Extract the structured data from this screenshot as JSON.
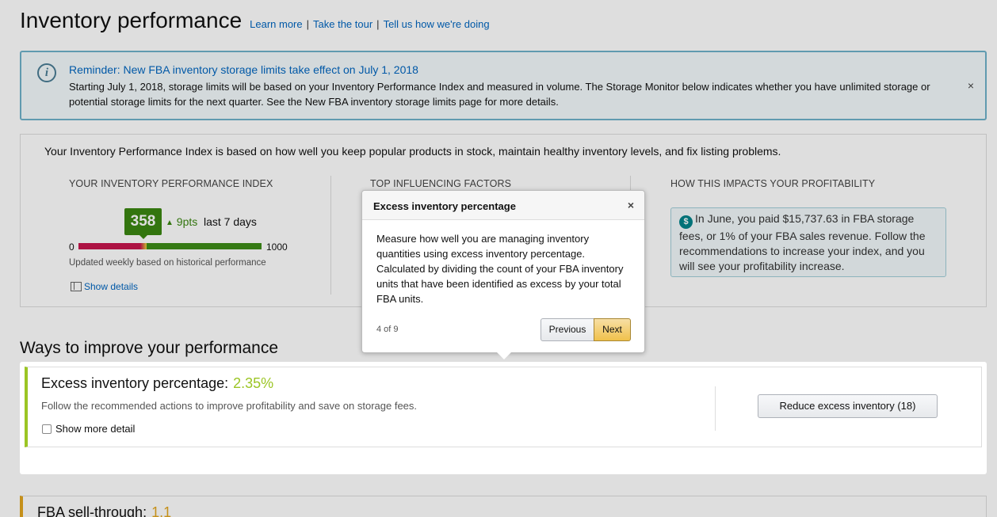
{
  "header": {
    "title": "Inventory performance",
    "links": [
      "Learn more",
      "Take the tour",
      "Tell us how we're doing"
    ],
    "separator": "|"
  },
  "reminder": {
    "title": "Reminder: New FBA inventory storage limits take effect on July 1, 2018",
    "body": "Starting July 1, 2018, storage limits will be based on your Inventory Performance Index and measured in volume. The Storage Monitor below indicates whether you have unlimited storage or potential storage limits for the next quarter. See the New FBA inventory storage limits page for more details.",
    "close": "×",
    "icon": "info-icon"
  },
  "ipi": {
    "intro": "Your Inventory Performance Index is based on how well you keep popular products in stock, maintain healthy inventory levels, and fix listing problems.",
    "col1_head": "YOUR INVENTORY PERFORMANCE INDEX",
    "col2_head": "TOP INFLUENCING FACTORS",
    "col3_head": "HOW THIS IMPACTS YOUR PROFITABILITY",
    "score": "358",
    "score_value": 358,
    "scale_min": "0",
    "scale_max": "1000",
    "trend": "9pts",
    "trend_arrow": "▲",
    "trend_period": "last 7 days",
    "updated": "Updated weekly based on historical performance",
    "show_details": "Show details",
    "impact_text": "In June, you paid $15,737.63 in FBA storage fees, or 1% of your FBA sales revenue. Follow the recommendations to increase your index, and you will see your profitability increase.",
    "colors": {
      "score_green": "#3b8712",
      "bar_red": "#c7154d",
      "bar_green": "#3d8d17"
    }
  },
  "ways": {
    "title": "Ways to improve your performance"
  },
  "excess_card": {
    "title": "Excess inventory percentage:",
    "value": "2.35%",
    "subtitle": "Follow the recommended actions to improve profitability and save on storage fees.",
    "checkbox_label": "Show more detail",
    "button": "Reduce excess inventory (18)",
    "accent": "#9bc524"
  },
  "fba_card": {
    "title": "FBA sell-through:",
    "value": "1.1",
    "accent": "#e3a61e"
  },
  "popover": {
    "title": "Excess inventory percentage",
    "close": "×",
    "body": "Measure how well you are managing inventory quantities using excess inventory percentage. Calculated by dividing the count of your FBA inventory units that have been identified as excess by your total FBA units.",
    "step": "4 of 9",
    "prev": "Previous",
    "next": "Next"
  }
}
